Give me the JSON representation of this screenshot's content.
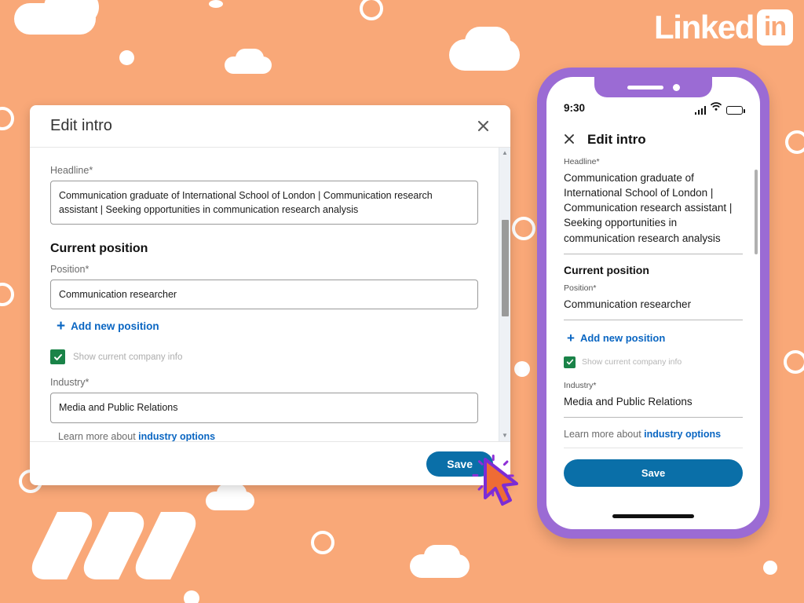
{
  "brand": {
    "name": "Linked",
    "badge_text": "in",
    "accent_blue": "#0a66c2",
    "button_blue": "#0a6fa8",
    "background_peach": "#F9A878",
    "phone_purple": "#9B6BD4",
    "checkbox_green": "#1a8348",
    "cursor_orange": "#EE6C35",
    "cursor_outline_purple": "#7B2CD6"
  },
  "desktop_modal": {
    "title": "Edit intro",
    "close_icon": "close-icon",
    "headline": {
      "label": "Headline*",
      "value": "Communication graduate of International School of London | Communication research assistant | Seeking opportunities in communication research analysis"
    },
    "section_title": "Current position",
    "position": {
      "label": "Position*",
      "value": "Communication researcher"
    },
    "add_position": {
      "icon": "plus-icon",
      "label": "Add new position"
    },
    "show_company": {
      "checked": true,
      "check_icon": "check-icon",
      "label": "Show current company info"
    },
    "industry": {
      "label": "Industry*",
      "value": "Media and Public Relations"
    },
    "learn_more": {
      "prefix": "Learn more about ",
      "link": "industry options"
    },
    "scrollbar": {
      "up_icon": "chevron-up-icon",
      "down_icon": "chevron-down-icon"
    },
    "save_label": "Save"
  },
  "phone": {
    "status": {
      "time": "9:30",
      "signal_icon": "signal-bars-icon",
      "wifi_icon": "wifi-icon",
      "battery_icon": "battery-icon"
    },
    "header": {
      "close_icon": "close-icon",
      "title": "Edit intro"
    },
    "headline": {
      "label": "Headline*",
      "value": "Communication graduate of International School of London | Communication research assistant | Seeking opportunities in communication research analysis"
    },
    "section_title": "Current position",
    "position": {
      "label": "Position*",
      "value": "Communication researcher"
    },
    "add_position": {
      "icon": "plus-icon",
      "label": "Add new position"
    },
    "show_company": {
      "checked": true,
      "check_icon": "check-icon",
      "label": "Show current company info"
    },
    "industry": {
      "label": "Industry*",
      "value": "Media and Public Relations"
    },
    "learn_more": {
      "prefix": "Learn more about ",
      "link": "industry options"
    },
    "save_label": "Save"
  },
  "pointer": {
    "icon": "mouse-cursor-icon",
    "state": "clicking"
  }
}
